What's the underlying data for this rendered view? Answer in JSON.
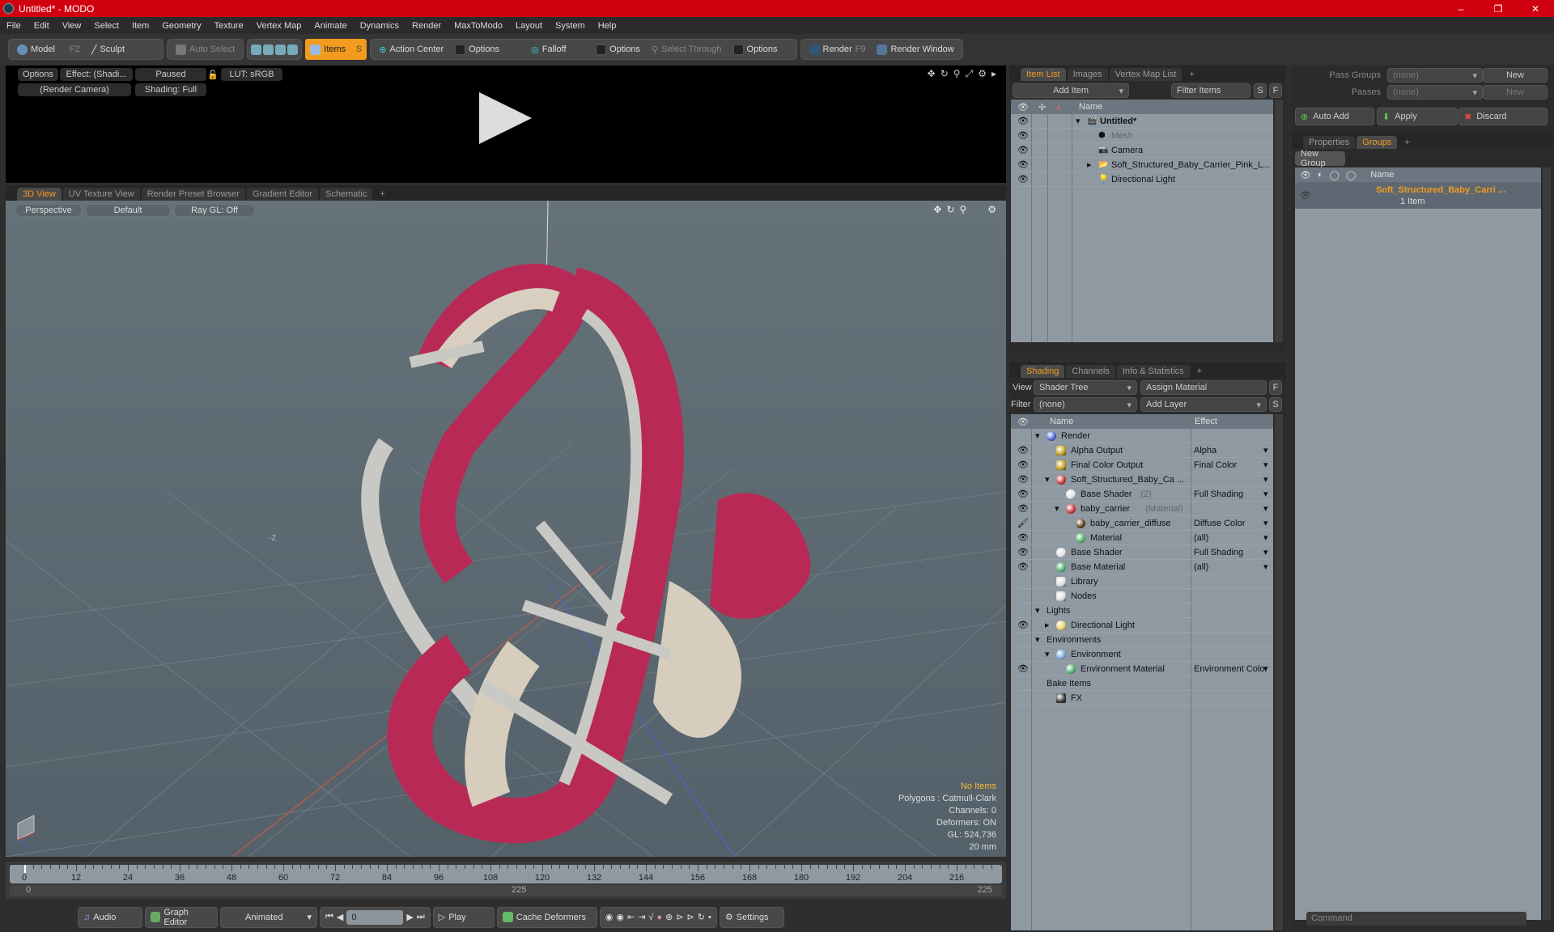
{
  "window": {
    "title": "Untitled* - MODO",
    "minimize": "–",
    "maximize": "❐",
    "close": "✕"
  },
  "menu": [
    "File",
    "Edit",
    "View",
    "Select",
    "Item",
    "Geometry",
    "Texture",
    "Vertex Map",
    "Animate",
    "Dynamics",
    "Render",
    "MaxToModo",
    "Layout",
    "System",
    "Help"
  ],
  "toolbar": {
    "model": "Model",
    "model_key": "F2",
    "sculpt": "Sculpt",
    "auto_select": "Auto Select",
    "items": "Items",
    "items_key": "S",
    "action_center": "Action Center",
    "options1": "Options",
    "falloff": "Falloff",
    "options2": "Options",
    "select_through": "Select Through",
    "options3": "Options",
    "render": "Render",
    "render_key": "F9",
    "render_window": "Render Window",
    "accent": "#f39b1f"
  },
  "preview": {
    "options": "Options",
    "effect": "Effect: (Shadi...",
    "paused": "Paused",
    "lut": "LUT: sRGB",
    "camera": "(Render Camera)",
    "shading": "Shading: Full"
  },
  "viewport_tabs": [
    {
      "label": "3D View",
      "selected": true
    },
    {
      "label": "UV Texture View"
    },
    {
      "label": "Render Preset Browser"
    },
    {
      "label": "Gradient Editor"
    },
    {
      "label": "Schematic"
    },
    {
      "label": "+"
    }
  ],
  "viewport": {
    "perspective": "Perspective",
    "default": "Default",
    "raygl": "Ray GL: Off",
    "axis_label": "-Z",
    "info": {
      "selection": "No Items",
      "polygons": "Polygons : Catmull-Clark",
      "channels": "Channels: 0",
      "deformers": "Deformers: ON",
      "gl": "GL: 524,736",
      "scale": "20 mm"
    }
  },
  "timeline": {
    "ticks": [
      0,
      12,
      24,
      36,
      48,
      60,
      72,
      84,
      96,
      108,
      120,
      132,
      144,
      156,
      168,
      180,
      192,
      204,
      216
    ],
    "end": 225,
    "current": 0,
    "range_start": "0",
    "range_mid": "225",
    "range_end": "225"
  },
  "bottombar": {
    "audio": "Audio",
    "graph_editor": "Graph Editor",
    "animated": "Animated",
    "frame": "0",
    "play": "Play",
    "cache": "Cache Deformers",
    "settings": "Settings"
  },
  "item_list": {
    "tabs": [
      {
        "label": "Item List",
        "selected": true
      },
      {
        "label": "Images"
      },
      {
        "label": "Vertex Map List"
      },
      {
        "label": "+"
      }
    ],
    "add_item": "Add Item",
    "filter": "Filter Items",
    "s": "S",
    "f": "F",
    "col_name": "Name",
    "rows": [
      {
        "name": "Untitled*",
        "depth": 0,
        "bold": true,
        "expanded": true
      },
      {
        "name": "Mesh",
        "depth": 1,
        "dim": true
      },
      {
        "name": "Camera",
        "depth": 1
      },
      {
        "name": "Soft_Structured_Baby_Carrier_Pink_L...",
        "depth": 1,
        "collapsed": true
      },
      {
        "name": "Directional Light",
        "depth": 1
      }
    ]
  },
  "shading": {
    "tabs": [
      {
        "label": "Shading",
        "selected": true
      },
      {
        "label": "Channels"
      },
      {
        "label": "Info & Statistics"
      },
      {
        "label": "+"
      }
    ],
    "view_label": "View",
    "view_value": "Shader Tree",
    "assign": "Assign Material",
    "f": "F",
    "filter_label": "Filter",
    "filter_value": "(none)",
    "add_layer": "Add Layer",
    "s": "S",
    "col_name": "Name",
    "col_effect": "Effect",
    "rows": [
      {
        "name": "Render",
        "depth": 0,
        "expanded": true,
        "icon": "render-sphere-icon",
        "color": "#4a5fd0"
      },
      {
        "name": "Alpha Output",
        "depth": 1,
        "eye": true,
        "effect": "Alpha",
        "icon": "output-icon",
        "color": "#c9a020"
      },
      {
        "name": "Final Color Output",
        "depth": 1,
        "eye": true,
        "effect": "Final Color",
        "icon": "output-icon",
        "color": "#c9a020"
      },
      {
        "name": "Soft_Structured_Baby_Ca ...",
        "depth": 1,
        "eye": true,
        "expanded": true,
        "effect": "",
        "icon": "material-group-icon",
        "color": "#c83030"
      },
      {
        "name": "Base Shader",
        "suffix": "(2)",
        "depth": 2,
        "eye": true,
        "effect": "Full Shading",
        "icon": "shader-icon",
        "color": "#e0e0e0"
      },
      {
        "name": "baby_carrier",
        "suffix": "(Material)",
        "depth": 2,
        "eye": true,
        "expanded": true,
        "effect": "",
        "icon": "material-group-icon",
        "color": "#c83030"
      },
      {
        "name": "baby_carrier_diffuse",
        "suffix": "...",
        "depth": 3,
        "brush": true,
        "effect": "Diffuse Color",
        "icon": "texture-icon",
        "color": "#5a3a10"
      },
      {
        "name": "Material",
        "depth": 3,
        "eye": true,
        "effect": "(all)",
        "icon": "material-icon",
        "color": "#4caf6a"
      },
      {
        "name": "Base Shader",
        "depth": 1,
        "eye": true,
        "effect": "Full Shading",
        "icon": "shader-icon",
        "color": "#e0e0e0"
      },
      {
        "name": "Base Material",
        "depth": 1,
        "eye": true,
        "effect": "(all)",
        "icon": "material-icon",
        "color": "#4caf6a"
      },
      {
        "name": "Library",
        "depth": 1,
        "icon": "folder-icon",
        "color": "#ddd"
      },
      {
        "name": "Nodes",
        "depth": 1,
        "icon": "folder-icon",
        "color": "#ddd"
      },
      {
        "name": "Lights",
        "depth": 0,
        "expanded": true
      },
      {
        "name": "Directional Light",
        "depth": 1,
        "eye": true,
        "collapsed": true,
        "icon": "light-icon",
        "color": "#e8d060"
      },
      {
        "name": "Environments",
        "depth": 0,
        "expanded": true
      },
      {
        "name": "Environment",
        "depth": 1,
        "expanded": true,
        "icon": "environment-icon",
        "color": "#7aa8e0"
      },
      {
        "name": "Environment Material",
        "depth": 2,
        "eye": true,
        "effect": "Environment Color",
        "icon": "material-icon",
        "color": "#4caf6a"
      },
      {
        "name": "Bake Items",
        "depth": 0
      },
      {
        "name": "FX",
        "depth": 1,
        "icon": "clapper-icon",
        "color": "#333"
      }
    ]
  },
  "groups": {
    "pass_groups": "Pass Groups",
    "pass_value": "(none)",
    "new1": "New",
    "passes": "Passes",
    "passes_value": "(none)",
    "new2": "New",
    "auto_add": "Auto Add",
    "apply": "Apply",
    "discard": "Discard",
    "tabs": [
      {
        "label": "Properties"
      },
      {
        "label": "Groups",
        "selected": true
      },
      {
        "label": "+"
      }
    ],
    "new_group": "New Group",
    "col_name": "Name",
    "group_name": "Soft_Structured_Baby_Carri ...",
    "group_count": "1 Item"
  },
  "command": {
    "placeholder": "Command"
  },
  "colors": {
    "title_bar": "#d0000f",
    "accent": "#f39b1f",
    "carrier_pink": "#b82a55",
    "strap_gray": "#c8c8c4"
  }
}
